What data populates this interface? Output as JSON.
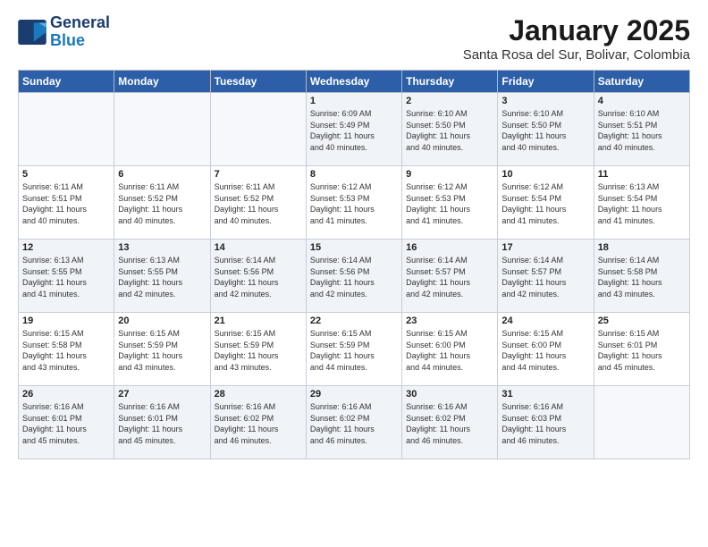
{
  "header": {
    "logo_line1": "General",
    "logo_line2": "Blue",
    "month": "January 2025",
    "location": "Santa Rosa del Sur, Bolivar, Colombia"
  },
  "weekdays": [
    "Sunday",
    "Monday",
    "Tuesday",
    "Wednesday",
    "Thursday",
    "Friday",
    "Saturday"
  ],
  "weeks": [
    [
      {
        "day": "",
        "info": ""
      },
      {
        "day": "",
        "info": ""
      },
      {
        "day": "",
        "info": ""
      },
      {
        "day": "1",
        "info": "Sunrise: 6:09 AM\nSunset: 5:49 PM\nDaylight: 11 hours\nand 40 minutes."
      },
      {
        "day": "2",
        "info": "Sunrise: 6:10 AM\nSunset: 5:50 PM\nDaylight: 11 hours\nand 40 minutes."
      },
      {
        "day": "3",
        "info": "Sunrise: 6:10 AM\nSunset: 5:50 PM\nDaylight: 11 hours\nand 40 minutes."
      },
      {
        "day": "4",
        "info": "Sunrise: 6:10 AM\nSunset: 5:51 PM\nDaylight: 11 hours\nand 40 minutes."
      }
    ],
    [
      {
        "day": "5",
        "info": "Sunrise: 6:11 AM\nSunset: 5:51 PM\nDaylight: 11 hours\nand 40 minutes."
      },
      {
        "day": "6",
        "info": "Sunrise: 6:11 AM\nSunset: 5:52 PM\nDaylight: 11 hours\nand 40 minutes."
      },
      {
        "day": "7",
        "info": "Sunrise: 6:11 AM\nSunset: 5:52 PM\nDaylight: 11 hours\nand 40 minutes."
      },
      {
        "day": "8",
        "info": "Sunrise: 6:12 AM\nSunset: 5:53 PM\nDaylight: 11 hours\nand 41 minutes."
      },
      {
        "day": "9",
        "info": "Sunrise: 6:12 AM\nSunset: 5:53 PM\nDaylight: 11 hours\nand 41 minutes."
      },
      {
        "day": "10",
        "info": "Sunrise: 6:12 AM\nSunset: 5:54 PM\nDaylight: 11 hours\nand 41 minutes."
      },
      {
        "day": "11",
        "info": "Sunrise: 6:13 AM\nSunset: 5:54 PM\nDaylight: 11 hours\nand 41 minutes."
      }
    ],
    [
      {
        "day": "12",
        "info": "Sunrise: 6:13 AM\nSunset: 5:55 PM\nDaylight: 11 hours\nand 41 minutes."
      },
      {
        "day": "13",
        "info": "Sunrise: 6:13 AM\nSunset: 5:55 PM\nDaylight: 11 hours\nand 42 minutes."
      },
      {
        "day": "14",
        "info": "Sunrise: 6:14 AM\nSunset: 5:56 PM\nDaylight: 11 hours\nand 42 minutes."
      },
      {
        "day": "15",
        "info": "Sunrise: 6:14 AM\nSunset: 5:56 PM\nDaylight: 11 hours\nand 42 minutes."
      },
      {
        "day": "16",
        "info": "Sunrise: 6:14 AM\nSunset: 5:57 PM\nDaylight: 11 hours\nand 42 minutes."
      },
      {
        "day": "17",
        "info": "Sunrise: 6:14 AM\nSunset: 5:57 PM\nDaylight: 11 hours\nand 42 minutes."
      },
      {
        "day": "18",
        "info": "Sunrise: 6:14 AM\nSunset: 5:58 PM\nDaylight: 11 hours\nand 43 minutes."
      }
    ],
    [
      {
        "day": "19",
        "info": "Sunrise: 6:15 AM\nSunset: 5:58 PM\nDaylight: 11 hours\nand 43 minutes."
      },
      {
        "day": "20",
        "info": "Sunrise: 6:15 AM\nSunset: 5:59 PM\nDaylight: 11 hours\nand 43 minutes."
      },
      {
        "day": "21",
        "info": "Sunrise: 6:15 AM\nSunset: 5:59 PM\nDaylight: 11 hours\nand 43 minutes."
      },
      {
        "day": "22",
        "info": "Sunrise: 6:15 AM\nSunset: 5:59 PM\nDaylight: 11 hours\nand 44 minutes."
      },
      {
        "day": "23",
        "info": "Sunrise: 6:15 AM\nSunset: 6:00 PM\nDaylight: 11 hours\nand 44 minutes."
      },
      {
        "day": "24",
        "info": "Sunrise: 6:15 AM\nSunset: 6:00 PM\nDaylight: 11 hours\nand 44 minutes."
      },
      {
        "day": "25",
        "info": "Sunrise: 6:15 AM\nSunset: 6:01 PM\nDaylight: 11 hours\nand 45 minutes."
      }
    ],
    [
      {
        "day": "26",
        "info": "Sunrise: 6:16 AM\nSunset: 6:01 PM\nDaylight: 11 hours\nand 45 minutes."
      },
      {
        "day": "27",
        "info": "Sunrise: 6:16 AM\nSunset: 6:01 PM\nDaylight: 11 hours\nand 45 minutes."
      },
      {
        "day": "28",
        "info": "Sunrise: 6:16 AM\nSunset: 6:02 PM\nDaylight: 11 hours\nand 46 minutes."
      },
      {
        "day": "29",
        "info": "Sunrise: 6:16 AM\nSunset: 6:02 PM\nDaylight: 11 hours\nand 46 minutes."
      },
      {
        "day": "30",
        "info": "Sunrise: 6:16 AM\nSunset: 6:02 PM\nDaylight: 11 hours\nand 46 minutes."
      },
      {
        "day": "31",
        "info": "Sunrise: 6:16 AM\nSunset: 6:03 PM\nDaylight: 11 hours\nand 46 minutes."
      },
      {
        "day": "",
        "info": ""
      }
    ]
  ]
}
